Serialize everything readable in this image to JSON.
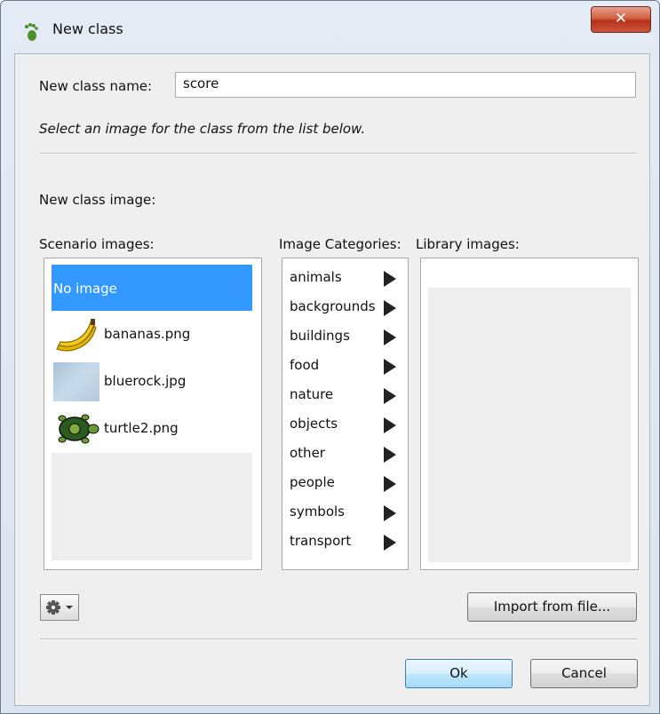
{
  "window": {
    "title": "New class",
    "close_glyph": "✕"
  },
  "form": {
    "name_label": "New class name:",
    "name_value": "score",
    "hint": "Select an image for the class from the list below.",
    "image_label": "New class image:"
  },
  "scenario": {
    "label": "Scenario images:",
    "items": [
      {
        "text": "No image",
        "selected": true
      },
      {
        "text": "bananas.png",
        "icon": "banana-icon"
      },
      {
        "text": "bluerock.jpg",
        "icon": "bluerock-thumbnail"
      },
      {
        "text": "turtle2.png",
        "icon": "turtle-icon"
      }
    ]
  },
  "categories": {
    "label": "Image Categories:",
    "items": [
      "animals",
      "backgrounds",
      "buildings",
      "food",
      "nature",
      "objects",
      "other",
      "people",
      "symbols",
      "transport"
    ]
  },
  "library": {
    "label": "Library images:"
  },
  "buttons": {
    "import": "Import from file...",
    "ok": "Ok",
    "cancel": "Cancel",
    "gear_menu": "gear-dropdown-icon"
  },
  "colors": {
    "selection": "#3399ff",
    "default_button": "#bee6fd",
    "close_button": "#c9553a"
  }
}
